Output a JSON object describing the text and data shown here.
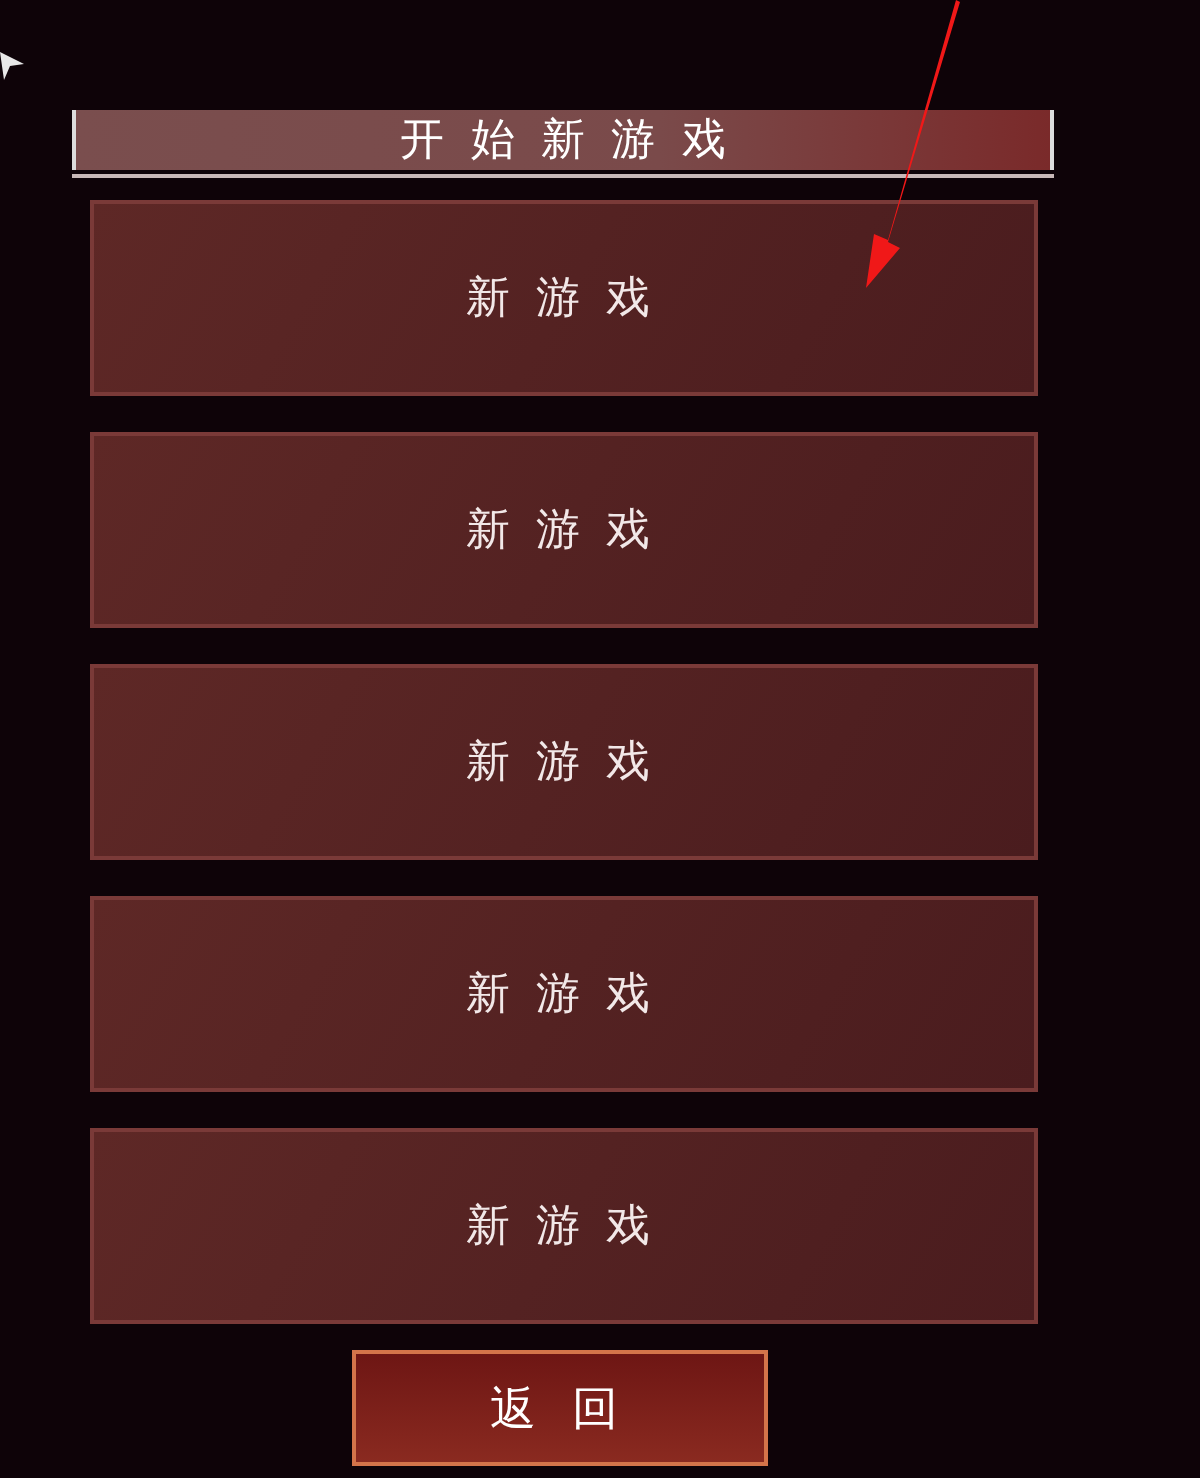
{
  "title": "开始新游戏",
  "slots": [
    {
      "label": "新游戏"
    },
    {
      "label": "新游戏"
    },
    {
      "label": "新游戏"
    },
    {
      "label": "新游戏"
    },
    {
      "label": "新游戏"
    }
  ],
  "back_button": {
    "label": "返回"
  }
}
